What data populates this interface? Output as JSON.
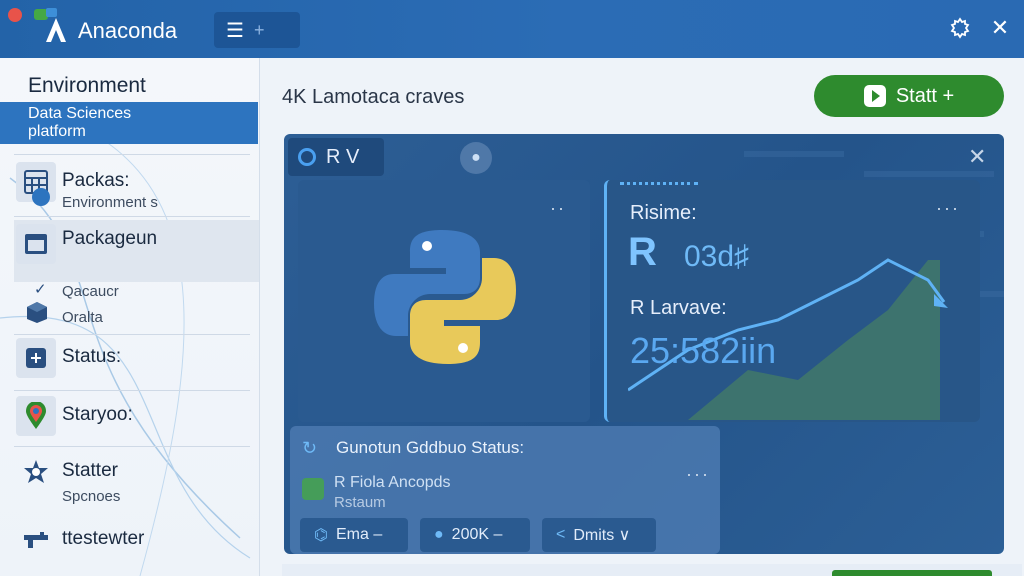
{
  "app": {
    "title": "Anaconda"
  },
  "titlebar": {
    "menu_icon": "hamburger-icon",
    "menu_plus": "+"
  },
  "sidebar": {
    "environment": "Environment",
    "selected": {
      "line1": "Data Sciences",
      "line2": "platform"
    },
    "items": [
      {
        "label": "Packas:",
        "sub": "Environment s",
        "icon": "calculator-icon"
      },
      {
        "label": "Packageun",
        "icon": "window-icon"
      },
      {
        "label": "Qacaucr",
        "sub": "Oralta",
        "icon": "box-icon"
      },
      {
        "label": "Status:",
        "icon": "plus-square-icon"
      },
      {
        "label": "Staryoo:",
        "icon": "map-pin-icon"
      },
      {
        "label": "Statter",
        "sub": "Spcnoes",
        "icon": "star-badge-icon"
      },
      {
        "label": "ttestewter",
        "icon": "tool-icon"
      }
    ]
  },
  "main": {
    "title": "4K Lamotaca craves",
    "start_button": "Statt +",
    "panel": {
      "tab_label": "R V",
      "runtime_label": "Risime:",
      "runtime_R": "R",
      "runtime_value": "03d♯",
      "language_label": "R Larvave:",
      "language_value": "25:582iin"
    },
    "status": {
      "title": "Gunotun Gddbuo Status:",
      "line1": "R  Fiola Ancopds",
      "line2": "Rstaum",
      "chips": [
        {
          "label": "Ema –",
          "icon": "python-icon"
        },
        {
          "label": "200K –",
          "icon": "pin-icon"
        },
        {
          "label": "Dmits ∨",
          "icon": "chart-icon"
        }
      ]
    }
  },
  "colors": {
    "accent": "#2d74bf",
    "titlebar": "#2363a8",
    "start": "#2e8b2e",
    "panel": "#2a5a90"
  }
}
